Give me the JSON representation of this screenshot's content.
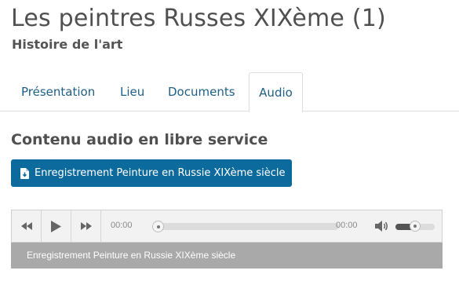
{
  "header": {
    "title": "Les peintres Russes XIXème (1)",
    "subtitle": "Histoire de l'art"
  },
  "tabs": [
    {
      "label": "Présentation",
      "active": false
    },
    {
      "label": "Lieu",
      "active": false
    },
    {
      "label": "Documents",
      "active": false
    },
    {
      "label": "Audio",
      "active": true
    }
  ],
  "section": {
    "title": "Contenu audio en libre service",
    "download_label": "Enregistrement Peinture en Russie XIXème siècle",
    "download_icon": "file-download-icon"
  },
  "player": {
    "rewind_icon": "rewind-icon",
    "play_icon": "play-icon",
    "forward_icon": "fast-forward-icon",
    "current_time": "00:00",
    "duration": "00:00",
    "progress": 0,
    "volume_icon": "volume-icon",
    "volume_level": 0.5,
    "caption": "Enregistrement Peinture en Russie XIXème siècle"
  },
  "colors": {
    "accent": "#0d6a9c",
    "tab_text": "#1f5f86",
    "caption_bg": "#a9a9a9"
  }
}
